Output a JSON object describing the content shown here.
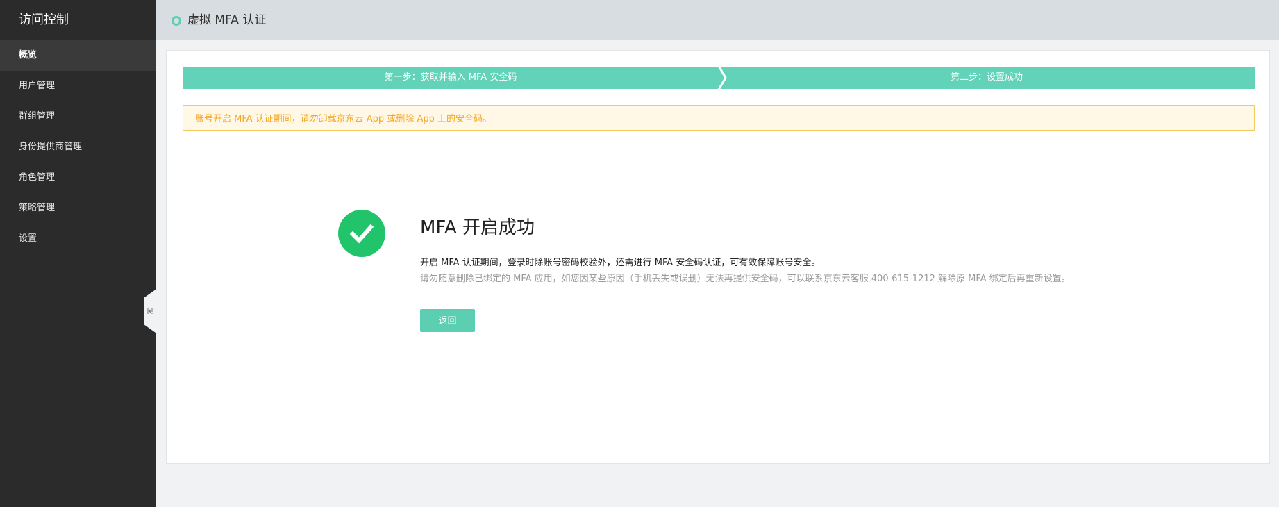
{
  "colors": {
    "sidebar_bg": "#2b2b2b",
    "sidebar_active_bg": "#3a3a3a",
    "topbar_bg": "#d8dde1",
    "accent_teal": "#62d3b8",
    "success_green": "#21c46b",
    "warning_text": "#f5a623",
    "warning_bg": "#fff8e6",
    "warning_border": "#f6c862"
  },
  "sidebar": {
    "title": "访问控制",
    "items": [
      {
        "label": "概览",
        "active": true
      },
      {
        "label": "用户管理",
        "active": false
      },
      {
        "label": "群组管理",
        "active": false
      },
      {
        "label": "身份提供商管理",
        "active": false
      },
      {
        "label": "角色管理",
        "active": false
      },
      {
        "label": "策略管理",
        "active": false
      },
      {
        "label": "设置",
        "active": false
      }
    ],
    "collapse_icon": "collapse-left-icon"
  },
  "header": {
    "title": "虚拟 MFA 认证",
    "status_icon": "circle-icon"
  },
  "steps": [
    {
      "label": "第一步：获取并输入 MFA 安全码"
    },
    {
      "label": "第二步：设置成功"
    }
  ],
  "warning": {
    "text": "账号开启 MFA 认证期间，请勿卸载京东云 App 或删除 App 上的安全码。"
  },
  "result": {
    "icon": "check-circle-icon",
    "title": "MFA 开启成功",
    "description": "开启 MFA 认证期间，登录时除账号密码校验外，还需进行 MFA 安全码认证，可有效保障账号安全。",
    "note": "请勿随意删除已绑定的 MFA 应用，如您因某些原因（手机丢失或误删）无法再提供安全码，可以联系京东云客服 400-615-1212 解除原 MFA 绑定后再重新设置。",
    "back_label": "返回"
  }
}
